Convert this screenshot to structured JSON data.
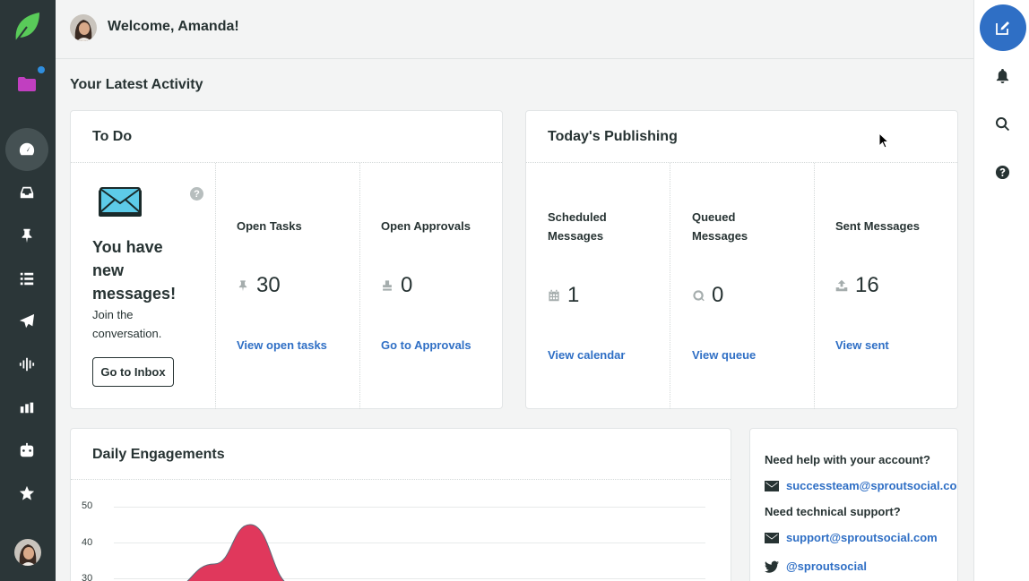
{
  "header": {
    "welcome": "Welcome, Amanda!"
  },
  "section_title": "Your Latest Activity",
  "todo": {
    "title": "To Do",
    "message_title": "You have new messages!",
    "message_sub": "Join the conversation.",
    "inbox_button": "Go to Inbox",
    "help_glyph": "?",
    "open_tasks": {
      "label": "Open Tasks",
      "value": "30",
      "icon": "pin-icon",
      "link": "View open tasks"
    },
    "open_approvals": {
      "label": "Open Approvals",
      "value": "0",
      "icon": "stamp-icon",
      "link": "Go to Approvals"
    }
  },
  "publishing": {
    "title": "Today's Publishing",
    "scheduled": {
      "label_line1": "Scheduled",
      "label_line2": "Messages",
      "value": "1",
      "icon": "calendar-icon",
      "link": "View calendar"
    },
    "queued": {
      "label_line1": "Queued",
      "label_line2": "Messages",
      "value": "0",
      "icon": "queue-icon",
      "link": "View queue"
    },
    "sent": {
      "label": "Sent Messages",
      "value": "16",
      "icon": "upload-icon",
      "link": "View sent"
    }
  },
  "engagements": {
    "title": "Daily Engagements"
  },
  "chart_data": {
    "type": "area",
    "title": "Daily Engagements",
    "y_ticks": [
      "50",
      "40",
      "30"
    ],
    "ylim": [
      0,
      50
    ],
    "grid": true,
    "series": [
      {
        "color": "#e0385c",
        "values": [
          27,
          34,
          45,
          28
        ]
      }
    ]
  },
  "support": {
    "account_question": "Need help with your account?",
    "account_email": "successteam@sproutsocial.com",
    "tech_question": "Need technical support?",
    "tech_email": "support@sproutsocial.com",
    "twitter": "@sproutsocial"
  },
  "colors": {
    "nav_bg": "#2b3638",
    "brand_green": "#59cb59",
    "link_blue": "#2f6fc5",
    "compose_blue": "#2f6fc5",
    "chart_red": "#e0385c"
  },
  "nav_icons": [
    "sprout-logo-icon",
    "folder-icon",
    "dashboard-icon",
    "inbox-icon",
    "pin-icon",
    "list-icon",
    "send-icon",
    "listening-icon",
    "reports-icon",
    "bot-icon",
    "star-review-icon",
    "user-avatar"
  ],
  "rail_icons": [
    "compose-icon",
    "bell-icon",
    "search-icon",
    "help-icon"
  ]
}
